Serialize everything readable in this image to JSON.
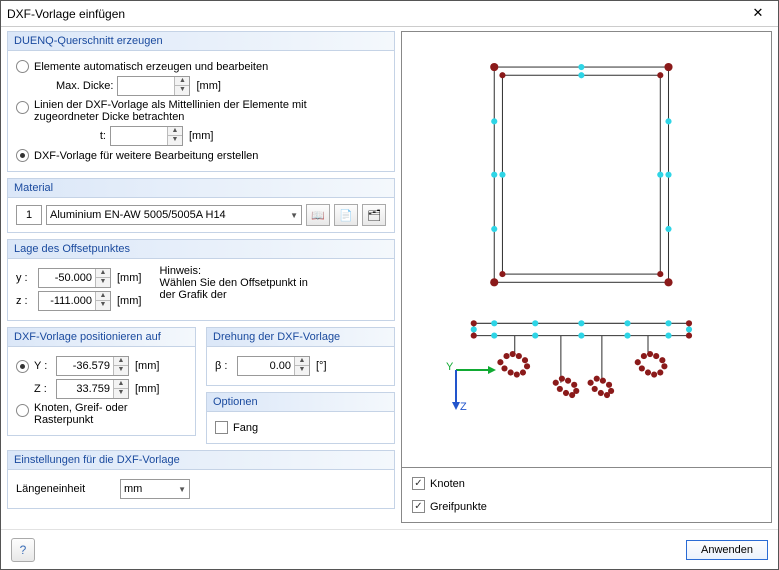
{
  "title": "DXF-Vorlage einfügen",
  "groups": {
    "create": {
      "header": "DUENQ-Querschnitt erzeugen",
      "opt_auto": "Elemente automatisch erzeugen und bearbeiten",
      "max_thick_label": "Max. Dicke:",
      "max_thick_value": "",
      "opt_midline": "Linien der DXF-Vorlage als Mittellinien der Elemente mit zugeordneter Dicke betrachten",
      "t_label": "t:",
      "t_value": "",
      "opt_further": "DXF-Vorlage für weitere Bearbeitung erstellen",
      "unit": "[mm]"
    },
    "material": {
      "header": "Material",
      "index": "1",
      "name": "Aluminium EN-AW 5005/5005A H14"
    },
    "offset": {
      "header": "Lage des Offsetpunktes",
      "y_label": "y :",
      "y_value": "-50.000",
      "z_label": "z :",
      "z_value": "-111.000",
      "unit": "[mm]",
      "hint_label": "Hinweis:",
      "hint_text": "Wählen Sie den Offsetpunkt in der Grafik der"
    },
    "position": {
      "header": "DXF-Vorlage positionieren auf",
      "opt_yz": "Y :",
      "y_value": "-36.579",
      "z_label": "Z :",
      "z_value": "33.759",
      "unit": "[mm]",
      "opt_node": "Knoten, Greif- oder Rasterpunkt"
    },
    "rotation": {
      "header": "Drehung der DXF-Vorlage",
      "beta_label": "β :",
      "beta_value": "0.00",
      "unit": "[°]"
    },
    "options": {
      "header": "Optionen",
      "snap": "Fang"
    },
    "settings": {
      "header": "Einstellungen für die DXF-Vorlage",
      "len_label": "Längeneinheit",
      "len_value": "mm"
    }
  },
  "preview_opts": {
    "nodes": "Knoten",
    "grips": "Greifpunkte"
  },
  "axes": {
    "y": "Y",
    "z": "Z"
  },
  "buttons": {
    "apply": "Anwenden"
  }
}
